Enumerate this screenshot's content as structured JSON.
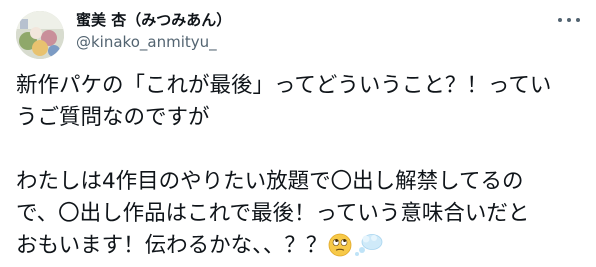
{
  "tweet": {
    "author": {
      "display_name": "蜜美 杏（みつみあん）",
      "handle": "@kinako_anmityu_"
    },
    "more_icon": "more-options-icon",
    "lines": [
      "新作パケの「これが最後」ってどういうこと？！ってい",
      "うご質問なのですが",
      "",
      "わたしは4作目のやりたい放題で〇出し解禁してるの",
      "で、〇出し作品はこれで最後！っていう意味合いだと"
    ],
    "last_line": "おもいます！伝わるかな、、？？",
    "emojis": [
      "face-with-rolling-eyes-emoji",
      "thought-balloon-emoji"
    ]
  }
}
